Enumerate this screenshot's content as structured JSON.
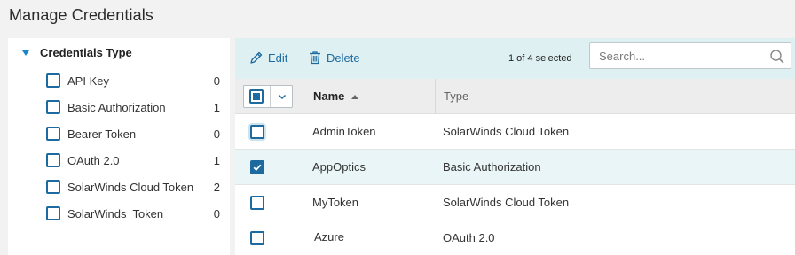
{
  "page": {
    "title": "Manage Credentials"
  },
  "filter": {
    "title": "Credentials Type",
    "items": [
      {
        "label": "API Key",
        "count": "0"
      },
      {
        "label": "Basic Authorization",
        "count": "1"
      },
      {
        "label": "Bearer Token",
        "count": "0"
      },
      {
        "label": "OAuth 2.0",
        "count": "1"
      },
      {
        "label": "SolarWinds Cloud Token",
        "count": "2"
      },
      {
        "label": "SolarWinds  Token",
        "count": "0"
      }
    ]
  },
  "toolbar": {
    "edit_label": "Edit",
    "delete_label": "Delete",
    "selection_status": "1 of 4 selected",
    "search": {
      "placeholder": "Search...",
      "value": ""
    }
  },
  "grid": {
    "columns": {
      "name": "Name",
      "type": "Type"
    },
    "rows": [
      {
        "name": "AdminToken",
        "type": "SolarWinds Cloud Token",
        "checked": false
      },
      {
        "name": "AppOptics",
        "type": "Basic Authorization",
        "checked": true
      },
      {
        "name": "MyToken",
        "type": "SolarWinds Cloud Token",
        "checked": false
      },
      {
        "name": "Azure",
        "type": "OAuth 2.0",
        "checked": false
      }
    ]
  },
  "colors": {
    "accent": "#1c6aa0",
    "toolbar_bg": "#dff0f2",
    "selected_row_bg": "#eaf5f7"
  },
  "icons": {
    "edit": "pencil-icon",
    "delete": "trash-icon",
    "search": "search-icon",
    "expand": "caret-down-icon",
    "sort": "sort-asc-icon",
    "bulk_menu": "chevron-down-icon"
  }
}
